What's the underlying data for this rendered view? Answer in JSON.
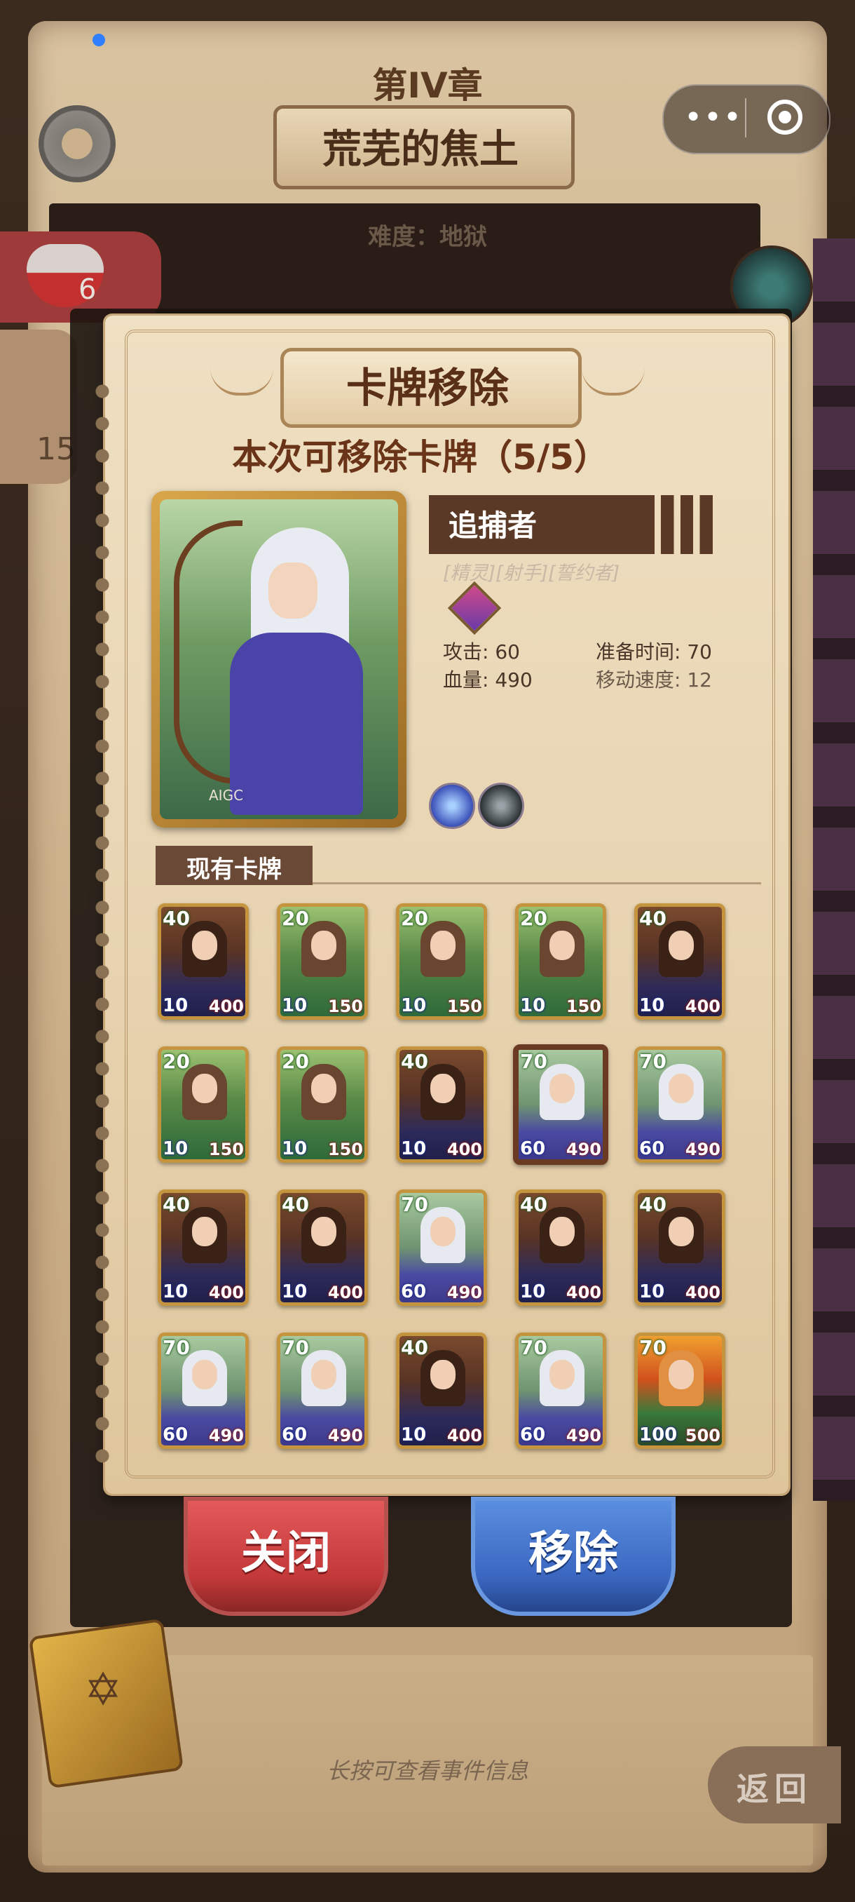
{
  "header": {
    "chapter": "第IV章",
    "stage_name": "荒芜的焦土",
    "difficulty": "难度：地狱",
    "capsule_more": "•••"
  },
  "status": {
    "hp_value": "6",
    "left_value": "15"
  },
  "dialog": {
    "title": "卡牌移除",
    "subtitle": "本次可移除卡牌（5/5）",
    "selected_card": {
      "name": "追捕者",
      "tags": "[精灵][射手][誓约者]",
      "attack": "攻击: 60",
      "hp": "血量: 490",
      "prep_time": "准备时间: 70",
      "move_speed": "移动速度: 12",
      "watermark": "AIGC"
    },
    "existing_label": "现有卡牌",
    "cards": [
      {
        "top": "40",
        "bl": "10",
        "br": "400",
        "art": "queen"
      },
      {
        "top": "20",
        "bl": "10",
        "br": "150",
        "art": "druid"
      },
      {
        "top": "20",
        "bl": "10",
        "br": "150",
        "art": "druid"
      },
      {
        "top": "20",
        "bl": "10",
        "br": "150",
        "art": "druid"
      },
      {
        "top": "40",
        "bl": "10",
        "br": "400",
        "art": "queen"
      },
      {
        "top": "20",
        "bl": "10",
        "br": "150",
        "art": "druid"
      },
      {
        "top": "20",
        "bl": "10",
        "br": "150",
        "art": "druid"
      },
      {
        "top": "40",
        "bl": "10",
        "br": "400",
        "art": "queen"
      },
      {
        "top": "70",
        "bl": "60",
        "br": "490",
        "art": "archer",
        "selected": true
      },
      {
        "top": "70",
        "bl": "60",
        "br": "490",
        "art": "archer"
      },
      {
        "top": "40",
        "bl": "10",
        "br": "400",
        "art": "queen"
      },
      {
        "top": "40",
        "bl": "10",
        "br": "400",
        "art": "queen"
      },
      {
        "top": "70",
        "bl": "60",
        "br": "490",
        "art": "archer"
      },
      {
        "top": "40",
        "bl": "10",
        "br": "400",
        "art": "queen"
      },
      {
        "top": "40",
        "bl": "10",
        "br": "400",
        "art": "queen"
      },
      {
        "top": "70",
        "bl": "60",
        "br": "490",
        "art": "archer"
      },
      {
        "top": "70",
        "bl": "60",
        "br": "490",
        "art": "archer"
      },
      {
        "top": "40",
        "bl": "10",
        "br": "400",
        "art": "queen"
      },
      {
        "top": "70",
        "bl": "60",
        "br": "490",
        "art": "archer"
      },
      {
        "top": "70",
        "bl": "100",
        "br": "500",
        "art": "fire"
      }
    ],
    "close_label": "关闭",
    "remove_label": "移除"
  },
  "footer": {
    "hint": "长按可查看事件信息",
    "back_label": "返回"
  },
  "colors": {
    "close_button": "#c23838",
    "remove_button": "#3a66c0",
    "card_border": "#c4943e"
  }
}
